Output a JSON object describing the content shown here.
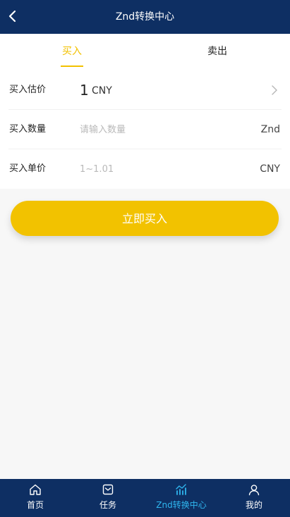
{
  "header": {
    "title": "Znd转换中心"
  },
  "tabs": [
    {
      "label": "买入",
      "active": true
    },
    {
      "label": "卖出",
      "active": false
    }
  ],
  "form": {
    "estimate": {
      "label": "买入估价",
      "value": "1",
      "unit": "CNY"
    },
    "quantity": {
      "label": "买入数量",
      "placeholder": "请输入数量",
      "unit": "Znd"
    },
    "unit_price": {
      "label": "买入单价",
      "placeholder": "1~1.01",
      "unit": "CNY"
    }
  },
  "buy_button": {
    "label": "立即买入"
  },
  "bottom_nav": {
    "items": [
      {
        "label": "首页",
        "icon": "home-icon",
        "active": false
      },
      {
        "label": "任务",
        "icon": "task-icon",
        "active": false
      },
      {
        "label": "Znd转换中心",
        "icon": "chart-icon",
        "active": true
      },
      {
        "label": "我的",
        "icon": "user-icon",
        "active": false
      }
    ]
  },
  "colors": {
    "header_bg": "#0e2f63",
    "accent": "#f2c100",
    "nav_active": "#2fb6ef",
    "page_bg": "#f7f7f7"
  }
}
